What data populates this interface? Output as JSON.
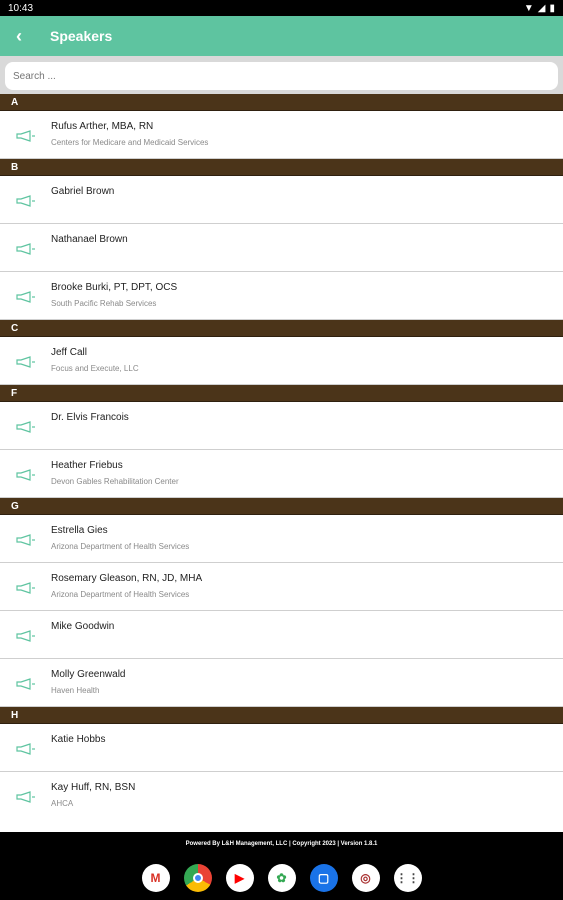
{
  "status": {
    "time": "10:43"
  },
  "header": {
    "title": "Speakers"
  },
  "search": {
    "placeholder": "Search ..."
  },
  "sections": [
    {
      "letter": "A",
      "speakers": [
        {
          "name": "Rufus Arther, MBA, RN",
          "org": "Centers for Medicare and Medicaid Services"
        }
      ]
    },
    {
      "letter": "B",
      "speakers": [
        {
          "name": "Gabriel Brown",
          "org": ""
        },
        {
          "name": "Nathanael Brown",
          "org": ""
        },
        {
          "name": "Brooke Burki, PT, DPT, OCS",
          "org": "South Pacific Rehab Services"
        }
      ]
    },
    {
      "letter": "C",
      "speakers": [
        {
          "name": "Jeff Call",
          "org": "Focus and Execute, LLC"
        }
      ]
    },
    {
      "letter": "F",
      "speakers": [
        {
          "name": "Dr. Elvis Francois",
          "org": ""
        },
        {
          "name": "Heather Friebus",
          "org": "Devon Gables Rehabilitation Center"
        }
      ]
    },
    {
      "letter": "G",
      "speakers": [
        {
          "name": "Estrella Gies",
          "org": "Arizona Department of Health Services"
        },
        {
          "name": "Rosemary Gleason, RN, JD, MHA",
          "org": "Arizona Department of Health Services"
        },
        {
          "name": "Mike Goodwin",
          "org": ""
        },
        {
          "name": "Molly Greenwald",
          "org": "Haven Health"
        }
      ]
    },
    {
      "letter": "H",
      "speakers": [
        {
          "name": "Katie Hobbs",
          "org": ""
        },
        {
          "name": "Kay Huff, RN, BSN",
          "org": "AHCA"
        }
      ]
    }
  ],
  "footer": {
    "text": "Powered By  L&H Management, LLC | Copyright 2023 | Version 1.8.1"
  },
  "icons": {
    "speaker": "megaphone-icon",
    "back": "back-arrow-icon"
  },
  "colors": {
    "appbar": "#5ec4a0",
    "section_header": "#4b3419",
    "icon": "#5ec4a0"
  }
}
